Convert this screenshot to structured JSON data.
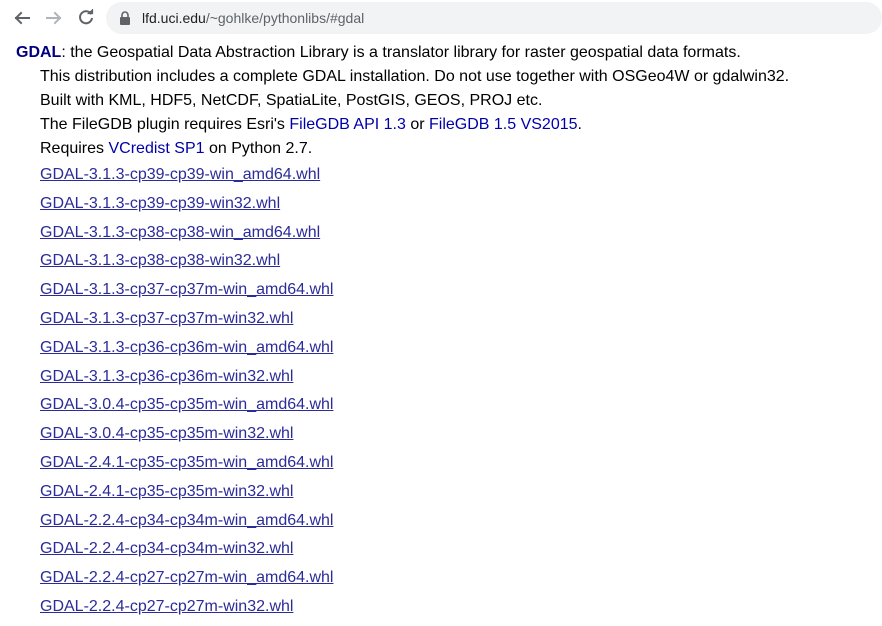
{
  "browser": {
    "url_host": "lfd.uci.edu",
    "url_path": "/~gohlke/pythonlibs/#gdal",
    "icons": [
      "back-icon",
      "forward-icon",
      "reload-icon",
      "lock-icon"
    ]
  },
  "entry": {
    "name": "GDAL",
    "description": ": the Geospatial Data Abstraction Library is a translator library for raster geospatial data formats.",
    "line2": "This distribution includes a complete GDAL installation. Do not use together with OSGeo4W or gdalwin32.",
    "line3": "Built with KML, HDF5, NetCDF, SpatiaLite, PostGIS, GEOS, PROJ etc.",
    "line4_prefix": "The FileGDB plugin requires Esri's ",
    "link_filegdb13": "FileGDB API 1.3",
    "line4_mid": " or ",
    "link_filegdb15": "FileGDB 1.5 VS2015",
    "line4_suffix": ".",
    "line5_prefix": "Requires ",
    "link_vcredist": "VCredist SP1",
    "line5_suffix": " on Python 2.7.",
    "files": [
      "GDAL-3.1.3-cp39-cp39-win_amd64.whl",
      "GDAL-3.1.3-cp39-cp39-win32.whl",
      "GDAL-3.1.3-cp38-cp38-win_amd64.whl",
      "GDAL-3.1.3-cp38-cp38-win32.whl",
      "GDAL-3.1.3-cp37-cp37m-win_amd64.whl",
      "GDAL-3.1.3-cp37-cp37m-win32.whl",
      "GDAL-3.1.3-cp36-cp36m-win_amd64.whl",
      "GDAL-3.1.3-cp36-cp36m-win32.whl",
      "GDAL-3.0.4-cp35-cp35m-win_amd64.whl",
      "GDAL-3.0.4-cp35-cp35m-win32.whl",
      "GDAL-2.4.1-cp35-cp35m-win_amd64.whl",
      "GDAL-2.4.1-cp35-cp35m-win32.whl",
      "GDAL-2.2.4-cp34-cp34m-win_amd64.whl",
      "GDAL-2.2.4-cp34-cp34m-win32.whl",
      "GDAL-2.2.4-cp27-cp27m-win_amd64.whl",
      "GDAL-2.2.4-cp27-cp27m-win32.whl"
    ]
  }
}
